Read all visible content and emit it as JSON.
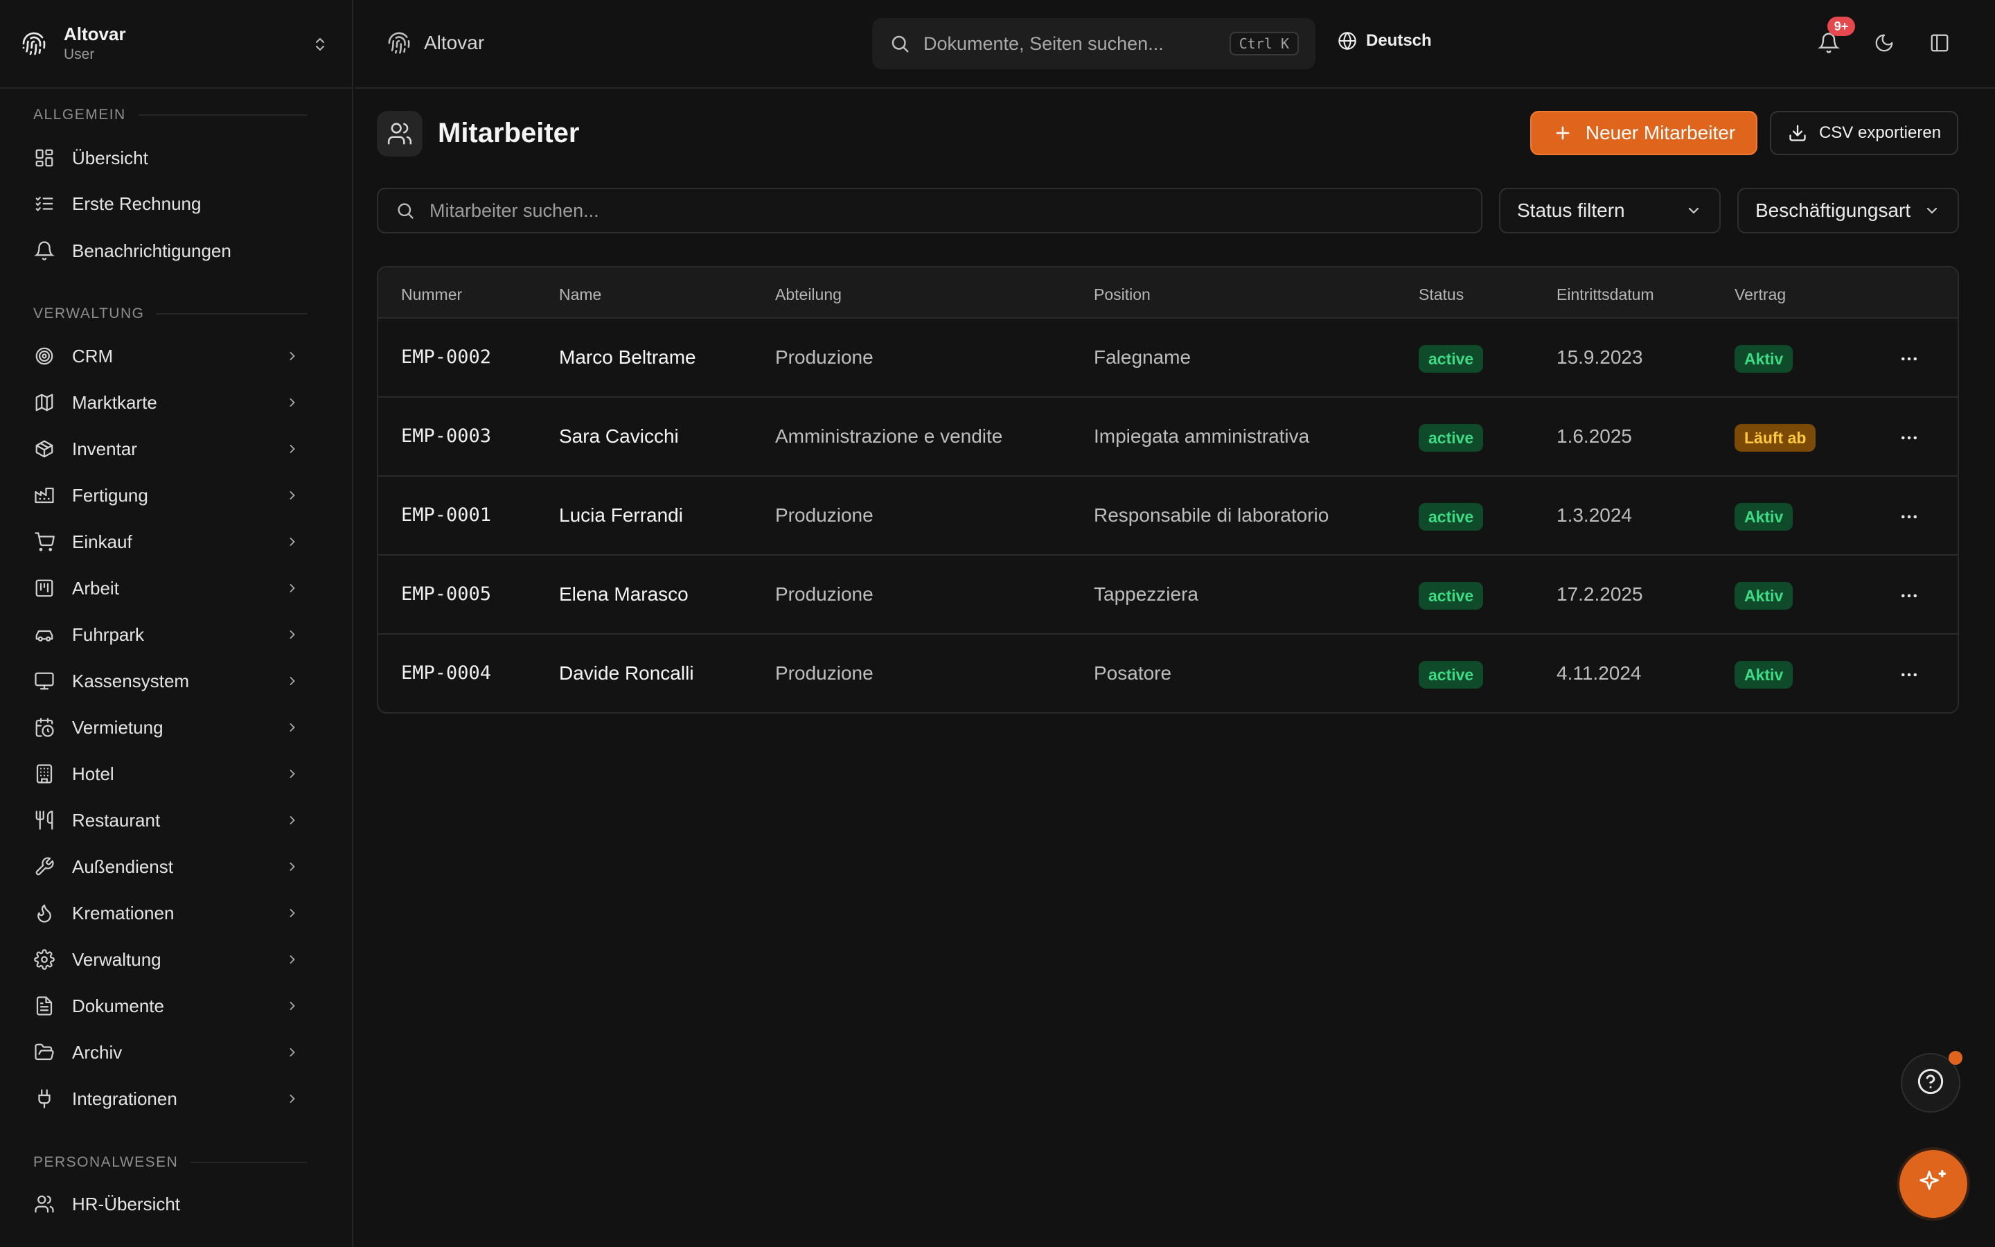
{
  "workspace": {
    "name": "Altovar",
    "role": "User"
  },
  "topbar": {
    "breadcrumb": "Altovar",
    "search_placeholder": "Dokumente, Seiten suchen...",
    "search_shortcut": "Ctrl K",
    "language": "Deutsch",
    "notification_count": "9+"
  },
  "sidebar": {
    "sections": [
      {
        "title": "ALLGEMEIN"
      },
      {
        "title": "VERWALTUNG"
      },
      {
        "title": "PERSONALWESEN"
      }
    ],
    "general": [
      {
        "label": "Übersicht",
        "icon": "dashboard-icon"
      },
      {
        "label": "Erste Rechnung",
        "icon": "list-check-icon"
      },
      {
        "label": "Benachrichtigungen",
        "icon": "bell-icon"
      }
    ],
    "admin": [
      {
        "label": "CRM",
        "icon": "target-icon"
      },
      {
        "label": "Marktkarte",
        "icon": "map-icon"
      },
      {
        "label": "Inventar",
        "icon": "package-icon"
      },
      {
        "label": "Fertigung",
        "icon": "factory-icon"
      },
      {
        "label": "Einkauf",
        "icon": "cart-icon"
      },
      {
        "label": "Arbeit",
        "icon": "kanban-icon"
      },
      {
        "label": "Fuhrpark",
        "icon": "car-icon"
      },
      {
        "label": "Kassensystem",
        "icon": "monitor-icon"
      },
      {
        "label": "Vermietung",
        "icon": "calendar-clock-icon"
      },
      {
        "label": "Hotel",
        "icon": "building-icon"
      },
      {
        "label": "Restaurant",
        "icon": "utensils-icon"
      },
      {
        "label": "Außendienst",
        "icon": "wrench-icon"
      },
      {
        "label": "Kremationen",
        "icon": "flame-icon"
      },
      {
        "label": "Verwaltung",
        "icon": "gear-icon"
      },
      {
        "label": "Dokumente",
        "icon": "file-icon"
      },
      {
        "label": "Archiv",
        "icon": "folder-open-icon"
      },
      {
        "label": "Integrationen",
        "icon": "plug-icon"
      }
    ],
    "hr": [
      {
        "label": "HR-Übersicht",
        "icon": "users-icon"
      }
    ]
  },
  "page": {
    "title": "Mitarbeiter",
    "new_button": "Neuer Mitarbeiter",
    "export_button": "CSV exportieren",
    "search_placeholder": "Mitarbeiter suchen...",
    "status_filter": "Status filtern",
    "employment_filter": "Beschäftigungsart"
  },
  "table": {
    "columns": [
      "Nummer",
      "Name",
      "Abteilung",
      "Position",
      "Status",
      "Eintrittsdatum",
      "Vertrag"
    ],
    "rows": [
      {
        "number": "EMP-0002",
        "name": "Marco Beltrame",
        "department": "Produzione",
        "position": "Falegname",
        "status": "active",
        "start": "15.9.2023",
        "contract": "Aktiv",
        "contract_tone": "green"
      },
      {
        "number": "EMP-0003",
        "name": "Sara Cavicchi",
        "department": "Amministrazione e vendite",
        "position": "Impiegata amministrativa",
        "status": "active",
        "start": "1.6.2025",
        "contract": "Läuft ab",
        "contract_tone": "amber"
      },
      {
        "number": "EMP-0001",
        "name": "Lucia Ferrandi",
        "department": "Produzione",
        "position": "Responsabile di laboratorio",
        "status": "active",
        "start": "1.3.2024",
        "contract": "Aktiv",
        "contract_tone": "green"
      },
      {
        "number": "EMP-0005",
        "name": "Elena Marasco",
        "department": "Produzione",
        "position": "Tappezziera",
        "status": "active",
        "start": "17.2.2025",
        "contract": "Aktiv",
        "contract_tone": "green"
      },
      {
        "number": "EMP-0004",
        "name": "Davide Roncalli",
        "department": "Produzione",
        "position": "Posatore",
        "status": "active",
        "start": "4.11.2024",
        "contract": "Aktiv",
        "contract_tone": "green"
      }
    ]
  },
  "colors": {
    "accent": "#e0651c",
    "badge": "#e5484d",
    "success": "#3ddc84",
    "warning": "#ffc83d"
  }
}
